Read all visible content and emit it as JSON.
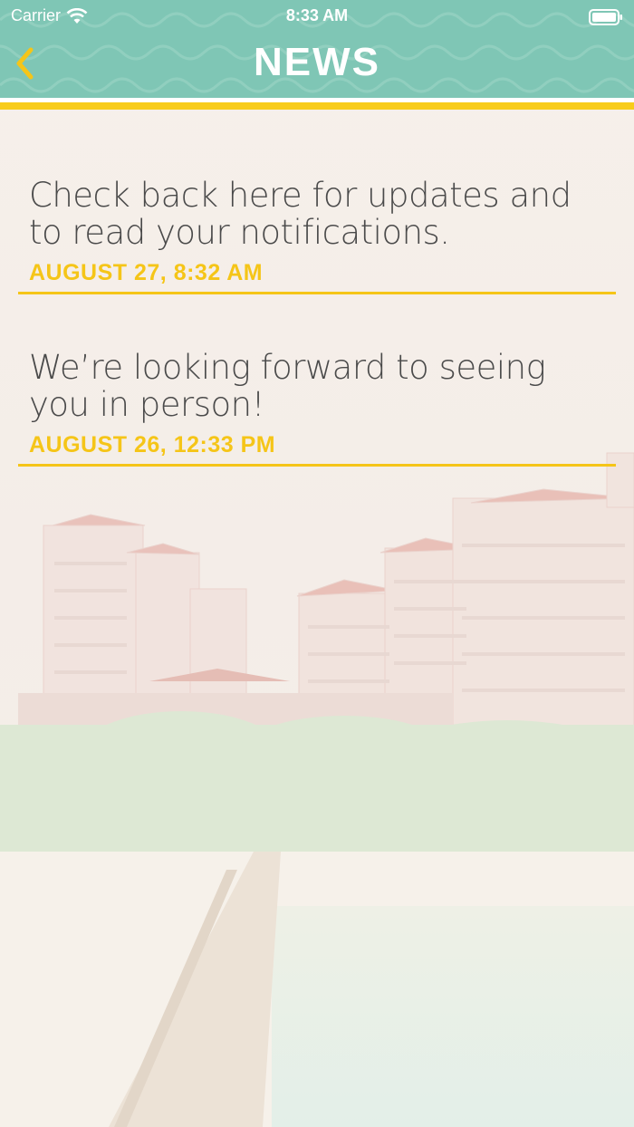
{
  "status_bar": {
    "carrier": "Carrier",
    "time": "8:33 AM"
  },
  "nav": {
    "title": "NEWS",
    "back_icon": "chevron-left-icon"
  },
  "colors": {
    "header_bg": "#7fc6b5",
    "accent_gold": "#f5c518",
    "text": "#4a4a4a"
  },
  "news": [
    {
      "text": "Check back here for updates and to read your notifications.",
      "date": "AUGUST 27, 8:32 AM"
    },
    {
      "text": "We’re looking forward to seeing you in person!",
      "date": "AUGUST 26, 12:33 PM"
    }
  ]
}
